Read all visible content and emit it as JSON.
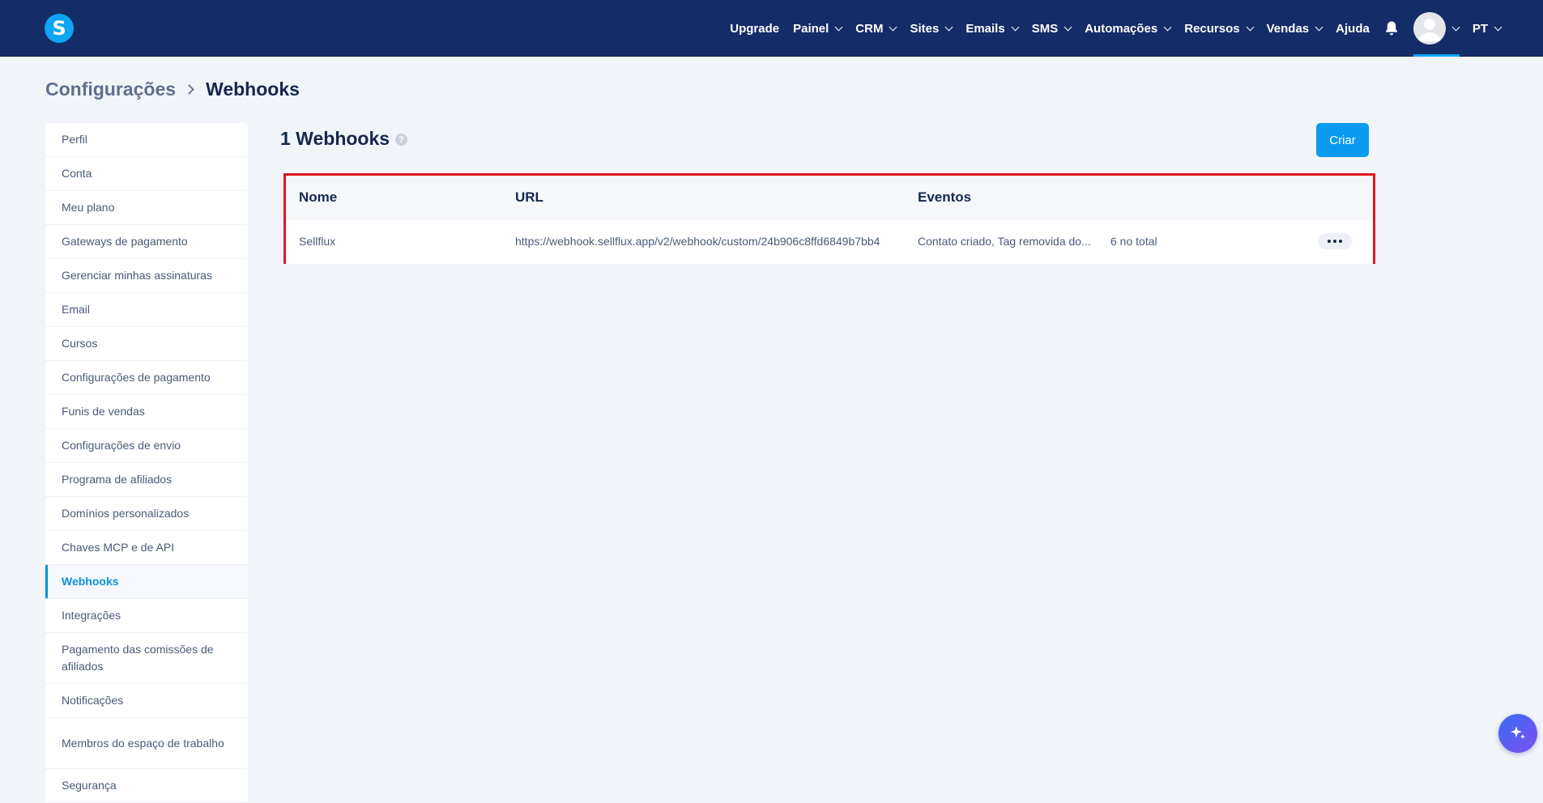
{
  "nav": {
    "logo": "S",
    "items": [
      {
        "label": "Upgrade",
        "dropdown": false
      },
      {
        "label": "Painel",
        "dropdown": true
      },
      {
        "label": "CRM",
        "dropdown": true
      },
      {
        "label": "Sites",
        "dropdown": true
      },
      {
        "label": "Emails",
        "dropdown": true
      },
      {
        "label": "SMS",
        "dropdown": true
      },
      {
        "label": "Automações",
        "dropdown": true
      },
      {
        "label": "Recursos",
        "dropdown": true
      },
      {
        "label": "Vendas",
        "dropdown": true
      },
      {
        "label": "Ajuda",
        "dropdown": false
      }
    ],
    "language": "PT"
  },
  "breadcrumb": {
    "parent": "Configurações",
    "current": "Webhooks"
  },
  "sidebar": {
    "items": [
      {
        "label": "Perfil"
      },
      {
        "label": "Conta"
      },
      {
        "label": "Meu plano"
      },
      {
        "label": "Gateways de pagamento"
      },
      {
        "label": "Gerenciar minhas assinaturas"
      },
      {
        "label": "Email"
      },
      {
        "label": "Cursos"
      },
      {
        "label": "Configurações de pagamento"
      },
      {
        "label": "Funis de vendas"
      },
      {
        "label": "Configurações de envio"
      },
      {
        "label": "Programa de afiliados"
      },
      {
        "label": "Domínios personalizados"
      },
      {
        "label": "Chaves MCP e de API"
      },
      {
        "label": "Webhooks",
        "active": true
      },
      {
        "label": "Integrações"
      },
      {
        "label": "Pagamento das comissões de afiliados",
        "double": true
      },
      {
        "label": "Notificações"
      },
      {
        "label": "Membros do espaço de trabalho",
        "double": true
      },
      {
        "label": "Segurança"
      }
    ]
  },
  "main": {
    "title": "1 Webhooks",
    "create_label": "Criar",
    "table": {
      "headers": {
        "name": "Nome",
        "url": "URL",
        "events": "Eventos"
      },
      "rows": [
        {
          "name": "Sellflux",
          "url": "https://webhook.sellflux.app/v2/webhook/custom/24b906c8ffd6849b7bb4",
          "events": "Contato criado, Tag removida do...",
          "events_total": "6 no total"
        }
      ]
    }
  },
  "colors": {
    "nav_bg": "#142c67",
    "accent": "#0a9af0",
    "highlight_border": "#e5141f"
  }
}
